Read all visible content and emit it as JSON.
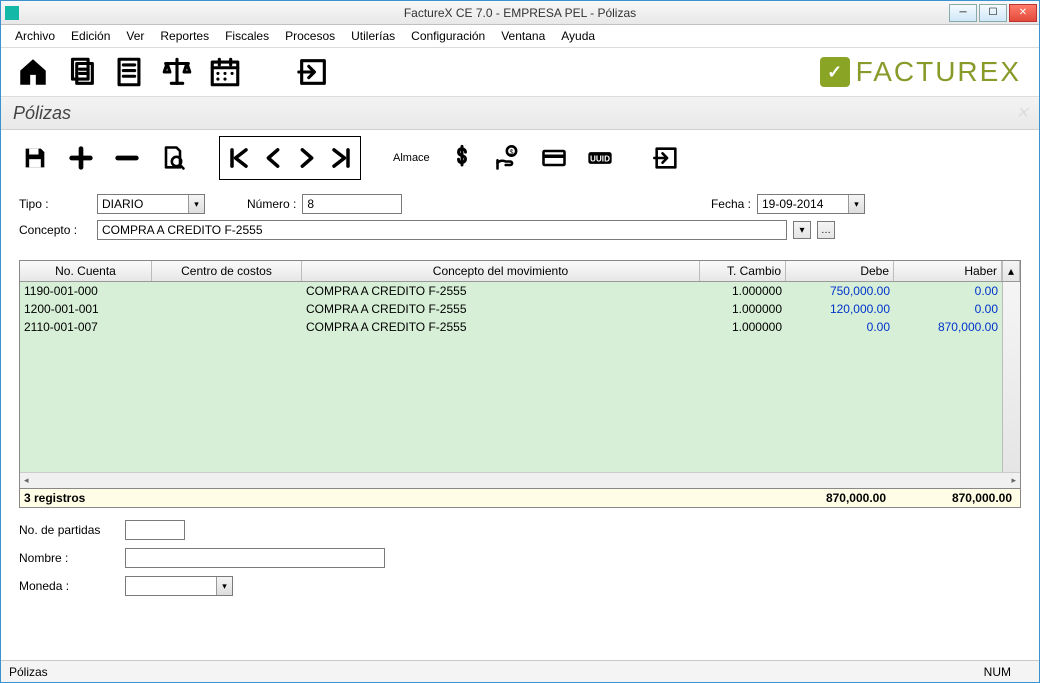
{
  "window": {
    "title": "FactureX CE 7.0 - EMPRESA PEL - Pólizas"
  },
  "menu": {
    "archivo": "Archivo",
    "edicion": "Edición",
    "ver": "Ver",
    "reportes": "Reportes",
    "fiscales": "Fiscales",
    "procesos": "Procesos",
    "utilerias": "Utilerías",
    "configuracion": "Configuración",
    "ventana": "Ventana",
    "ayuda": "Ayuda"
  },
  "brand": {
    "text": "FACTUREX"
  },
  "section": {
    "title": "Pólizas"
  },
  "toolbar2": {
    "almace_label": "Almace"
  },
  "form": {
    "tipo_label": "Tipo :",
    "tipo_value": "DIARIO",
    "numero_label": "Número :",
    "numero_value": "8",
    "fecha_label": "Fecha :",
    "fecha_value": "19-09-2014",
    "concepto_label": "Concepto :",
    "concepto_value": "COMPRA A CREDITO F-2555"
  },
  "grid": {
    "headers": {
      "cuenta": "No. Cuenta",
      "cc": "Centro de costos",
      "concepto": "Concepto del movimiento",
      "tc": "T. Cambio",
      "debe": "Debe",
      "haber": "Haber"
    },
    "rows": [
      {
        "cuenta": "1190-001-000",
        "cc": "",
        "concepto": "COMPRA A CREDITO F-2555",
        "tc": "1.000000",
        "debe": "750,000.00",
        "haber": "0.00"
      },
      {
        "cuenta": "1200-001-001",
        "cc": "",
        "concepto": "COMPRA A CREDITO F-2555",
        "tc": "1.000000",
        "debe": "120,000.00",
        "haber": "0.00"
      },
      {
        "cuenta": "2110-001-007",
        "cc": "",
        "concepto": "COMPRA A CREDITO F-2555",
        "tc": "1.000000",
        "debe": "0.00",
        "haber": "870,000.00"
      }
    ],
    "footer": {
      "count": "3 registros",
      "debe": "870,000.00",
      "haber": "870,000.00"
    }
  },
  "bottom": {
    "partidas_label": "No. de partidas",
    "partidas_value": "",
    "nombre_label": "Nombre :",
    "nombre_value": "",
    "moneda_label": "Moneda :",
    "moneda_value": ""
  },
  "status": {
    "left": "Pólizas",
    "num": "NUM"
  }
}
